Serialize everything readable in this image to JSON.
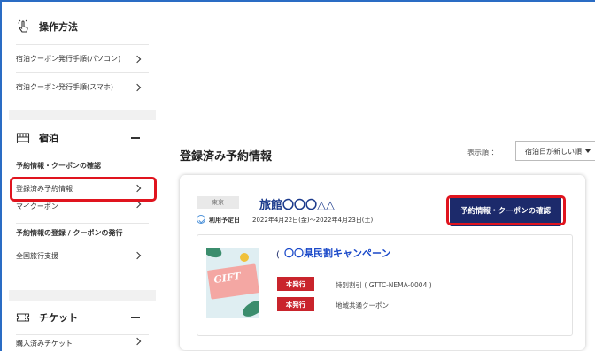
{
  "sidebar": {
    "guide": {
      "title": "操作方法",
      "items": [
        {
          "label": "宿泊クーポン発行手順(パソコン)"
        },
        {
          "label": "宿泊クーポン発行手順(スマホ)"
        }
      ]
    },
    "stay": {
      "title": "宿泊",
      "section1_label": "予約情報・クーポンの確認",
      "items1": [
        {
          "label": "登録済み予約情報"
        },
        {
          "label": "マイクーポン"
        }
      ],
      "section2_label": "予約情報の登録 / クーポンの発行",
      "items2": [
        {
          "label": "全国旅行支援"
        }
      ]
    },
    "ticket": {
      "title": "チケット",
      "items": [
        {
          "label": "購入済みチケット"
        }
      ]
    }
  },
  "main": {
    "title": "登録済み予約情報",
    "sort_label": "表示順 ：",
    "sort_value": "宿泊日が新しい順",
    "reservation": {
      "prefecture": "東京",
      "hotel_name": "旅館〇〇〇△△",
      "stay_label": "利用予定日",
      "stay_dates": "2022年4月22日(金)〜2022年4月23日(土)",
      "confirm_button": "予約情報・クーポンの確認",
      "campaign_prefix": "(",
      "campaign_title": "〇〇県民割キャンペーン",
      "coupons": [
        {
          "status": "本発行",
          "description": "特別割引 ( GTTC-NEMA-0004 )"
        },
        {
          "status": "本発行",
          "description": "地域共通クーポン"
        }
      ],
      "gift_image_text": "GIFT"
    }
  },
  "colors": {
    "accent_navy": "#1c2a6b",
    "highlight_red": "#e0141e",
    "tag_red": "#c9242c",
    "link_blue": "#1a49c9"
  }
}
